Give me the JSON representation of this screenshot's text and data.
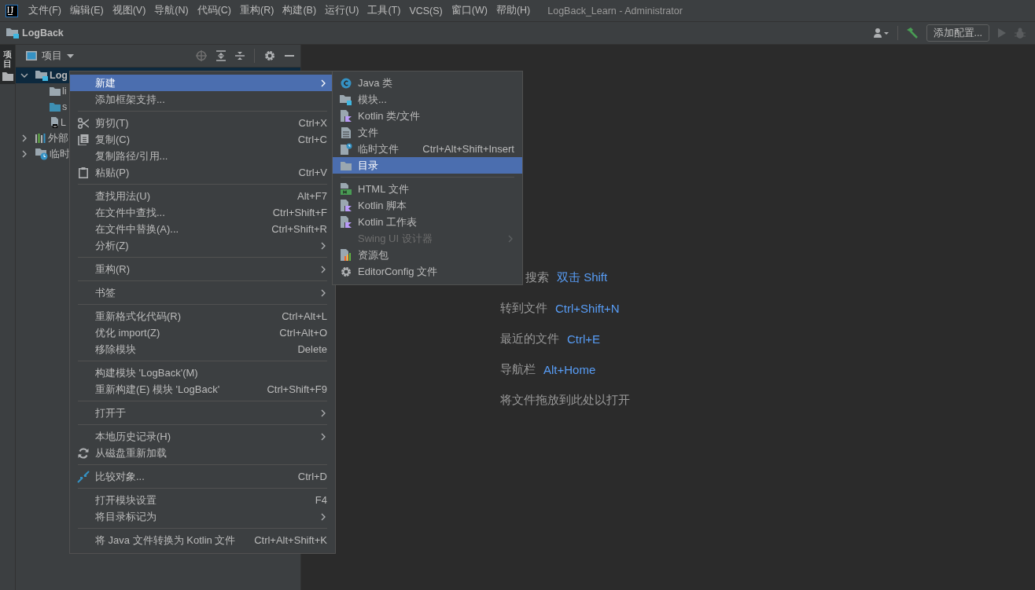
{
  "menu_bar": {
    "items": [
      "文件(F)",
      "编辑(E)",
      "视图(V)",
      "导航(N)",
      "代码(C)",
      "重构(R)",
      "构建(B)",
      "运行(U)",
      "工具(T)",
      "VCS(S)",
      "窗口(W)",
      "帮助(H)"
    ],
    "window_title": "LogBack_Learn - Administrator"
  },
  "nav_bar": {
    "breadcrumb": "LogBack",
    "run_config_button": "添加配置...",
    "run_enabled": false
  },
  "tool_tabs": [
    {
      "label": "项目",
      "selected": true
    }
  ],
  "project_panel": {
    "title": "项目",
    "tree": [
      {
        "label": "Log",
        "expanded": true,
        "selected": true,
        "children": [
          {
            "label": "li",
            "selected": false
          },
          {
            "label": "s",
            "selected": false
          },
          {
            "label": "L",
            "selected": false
          }
        ]
      },
      {
        "label": "外部",
        "expanded": false,
        "selected": false
      },
      {
        "label": "临时",
        "expanded": false,
        "selected": false
      }
    ]
  },
  "editor_hints": [
    {
      "label": "搜索",
      "shortcut": "双击 Shift",
      "partly_covered": true
    },
    {
      "label": "转到文件",
      "shortcut": "Ctrl+Shift+N",
      "partly_covered": false
    },
    {
      "label": "最近的文件",
      "shortcut": "Ctrl+E",
      "partly_covered": false
    },
    {
      "label": "导航栏",
      "shortcut": "Alt+Home",
      "partly_covered": false
    },
    {
      "label": "将文件拖放到此处以打开",
      "partly_covered": false
    }
  ],
  "context_menu": {
    "groups": [
      [
        {
          "label": "新建",
          "submenu": true,
          "selected": true
        },
        {
          "label": "添加框架支持...",
          "submenu": false,
          "selected": false
        }
      ],
      [
        {
          "label": "剪切(T)",
          "shortcut": "Ctrl+X",
          "submenu": false,
          "selected": false
        },
        {
          "label": "复制(C)",
          "shortcut": "Ctrl+C",
          "submenu": false,
          "selected": false
        },
        {
          "label": "复制路径/引用...",
          "submenu": false,
          "selected": false
        },
        {
          "label": "粘贴(P)",
          "shortcut": "Ctrl+V",
          "submenu": false,
          "selected": false
        }
      ],
      [
        {
          "label": "查找用法(U)",
          "shortcut": "Alt+F7",
          "submenu": false,
          "selected": false
        },
        {
          "label": "在文件中查找...",
          "shortcut": "Ctrl+Shift+F",
          "submenu": false,
          "selected": false
        },
        {
          "label": "在文件中替换(A)...",
          "shortcut": "Ctrl+Shift+R",
          "submenu": false,
          "selected": false
        },
        {
          "label": "分析(Z)",
          "submenu": true,
          "selected": false
        }
      ],
      [
        {
          "label": "重构(R)",
          "submenu": true,
          "selected": false
        }
      ],
      [
        {
          "label": "书签",
          "submenu": true,
          "selected": false
        }
      ],
      [
        {
          "label": "重新格式化代码(R)",
          "shortcut": "Ctrl+Alt+L",
          "submenu": false,
          "selected": false
        },
        {
          "label": "优化 import(Z)",
          "shortcut": "Ctrl+Alt+O",
          "submenu": false,
          "selected": false
        },
        {
          "label": "移除模块",
          "shortcut": "Delete",
          "submenu": false,
          "selected": false
        }
      ],
      [
        {
          "label": "构建模块 'LogBack'(M)",
          "submenu": false,
          "selected": false
        },
        {
          "label": "重新构建(E) 模块 'LogBack'",
          "shortcut": "Ctrl+Shift+F9",
          "submenu": false,
          "selected": false
        }
      ],
      [
        {
          "label": "打开于",
          "submenu": true,
          "selected": false
        }
      ],
      [
        {
          "label": "本地历史记录(H)",
          "submenu": true,
          "selected": false
        },
        {
          "label": "从磁盘重新加载",
          "submenu": false,
          "selected": false
        }
      ],
      [
        {
          "label": "比较对象...",
          "shortcut": "Ctrl+D",
          "submenu": false,
          "selected": false
        }
      ],
      [
        {
          "label": "打开模块设置",
          "shortcut": "F4",
          "submenu": false,
          "selected": false
        },
        {
          "label": "将目录标记为",
          "submenu": true,
          "selected": false
        }
      ],
      [
        {
          "label": "将 Java 文件转换为 Kotlin 文件",
          "shortcut": "Ctrl+Alt+Shift+K",
          "submenu": false,
          "selected": false
        }
      ]
    ]
  },
  "new_submenu": {
    "groups": [
      [
        {
          "label": "Java 类",
          "selected": false,
          "disabled": false,
          "submenu": false
        },
        {
          "label": "模块...",
          "selected": false,
          "disabled": false,
          "submenu": false
        },
        {
          "label": "Kotlin 类/文件",
          "selected": false,
          "disabled": false,
          "submenu": false
        },
        {
          "label": "文件",
          "selected": false,
          "disabled": false,
          "submenu": false
        },
        {
          "label": "临时文件",
          "shortcut": "Ctrl+Alt+Shift+Insert",
          "selected": false,
          "disabled": false,
          "submenu": false
        },
        {
          "label": "目录",
          "selected": true,
          "disabled": false,
          "submenu": false
        }
      ],
      [
        {
          "label": "HTML 文件",
          "selected": false,
          "disabled": false,
          "submenu": false
        },
        {
          "label": "Kotlin 脚本",
          "selected": false,
          "disabled": false,
          "submenu": false
        },
        {
          "label": "Kotlin 工作表",
          "selected": false,
          "disabled": false,
          "submenu": false
        },
        {
          "label": "Swing UI 设计器",
          "selected": false,
          "disabled": true,
          "submenu": true
        },
        {
          "label": "资源包",
          "selected": false,
          "disabled": false,
          "submenu": false
        },
        {
          "label": "EditorConfig 文件",
          "selected": false,
          "disabled": false,
          "submenu": false
        }
      ]
    ]
  }
}
